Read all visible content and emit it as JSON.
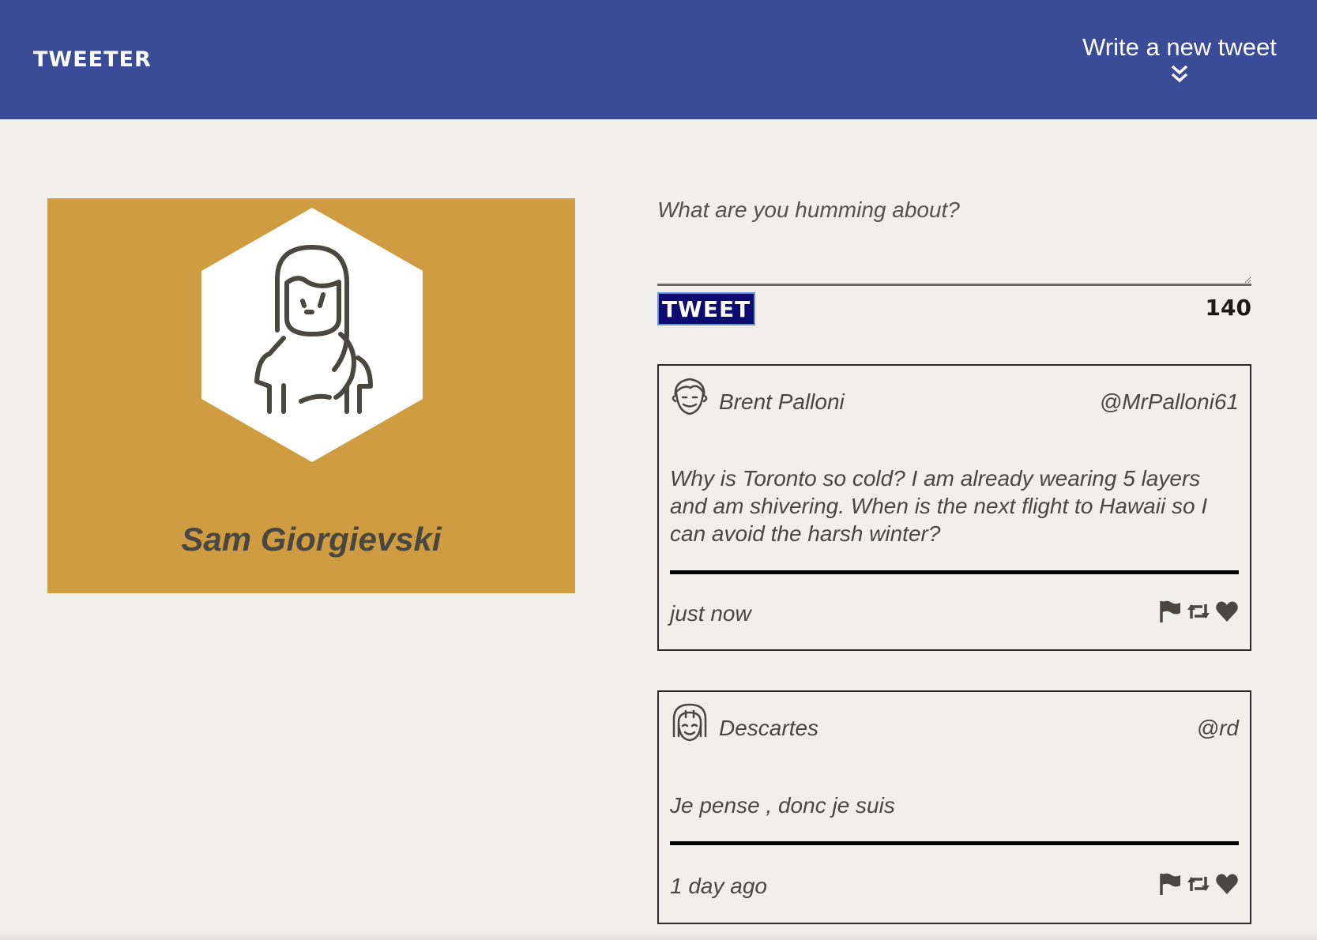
{
  "header": {
    "brand": "TWEETER",
    "compose_toggle_label": "Write a new tweet",
    "compose_toggle_icon": "double-chevron-down-icon",
    "background_color": "#3a4c97"
  },
  "profile": {
    "name": "Sam Giorgievski",
    "avatar_icon": "woman-avatar-icon",
    "card_color": "#cf9c42"
  },
  "composer": {
    "placeholder": "What are you humming about?",
    "value": "",
    "submit_label": "TWEET",
    "char_counter": "140"
  },
  "tweets": [
    {
      "author": "Brent Palloni",
      "handle": "@MrPalloni61",
      "avatar_icon": "man-avatar-icon",
      "text": "Why is Toronto so cold? I am already wearing 5 layers and am shivering. When is the next flight to Hawaii so I can avoid the harsh winter?",
      "time": "just now",
      "actions": [
        "flag-icon",
        "retweet-icon",
        "heart-icon"
      ]
    },
    {
      "author": "Descartes",
      "handle": "@rd",
      "avatar_icon": "woman-avatar-icon",
      "text": "Je pense , donc je suis",
      "time": "1 day ago",
      "actions": [
        "flag-icon",
        "retweet-icon",
        "heart-icon"
      ]
    }
  ]
}
